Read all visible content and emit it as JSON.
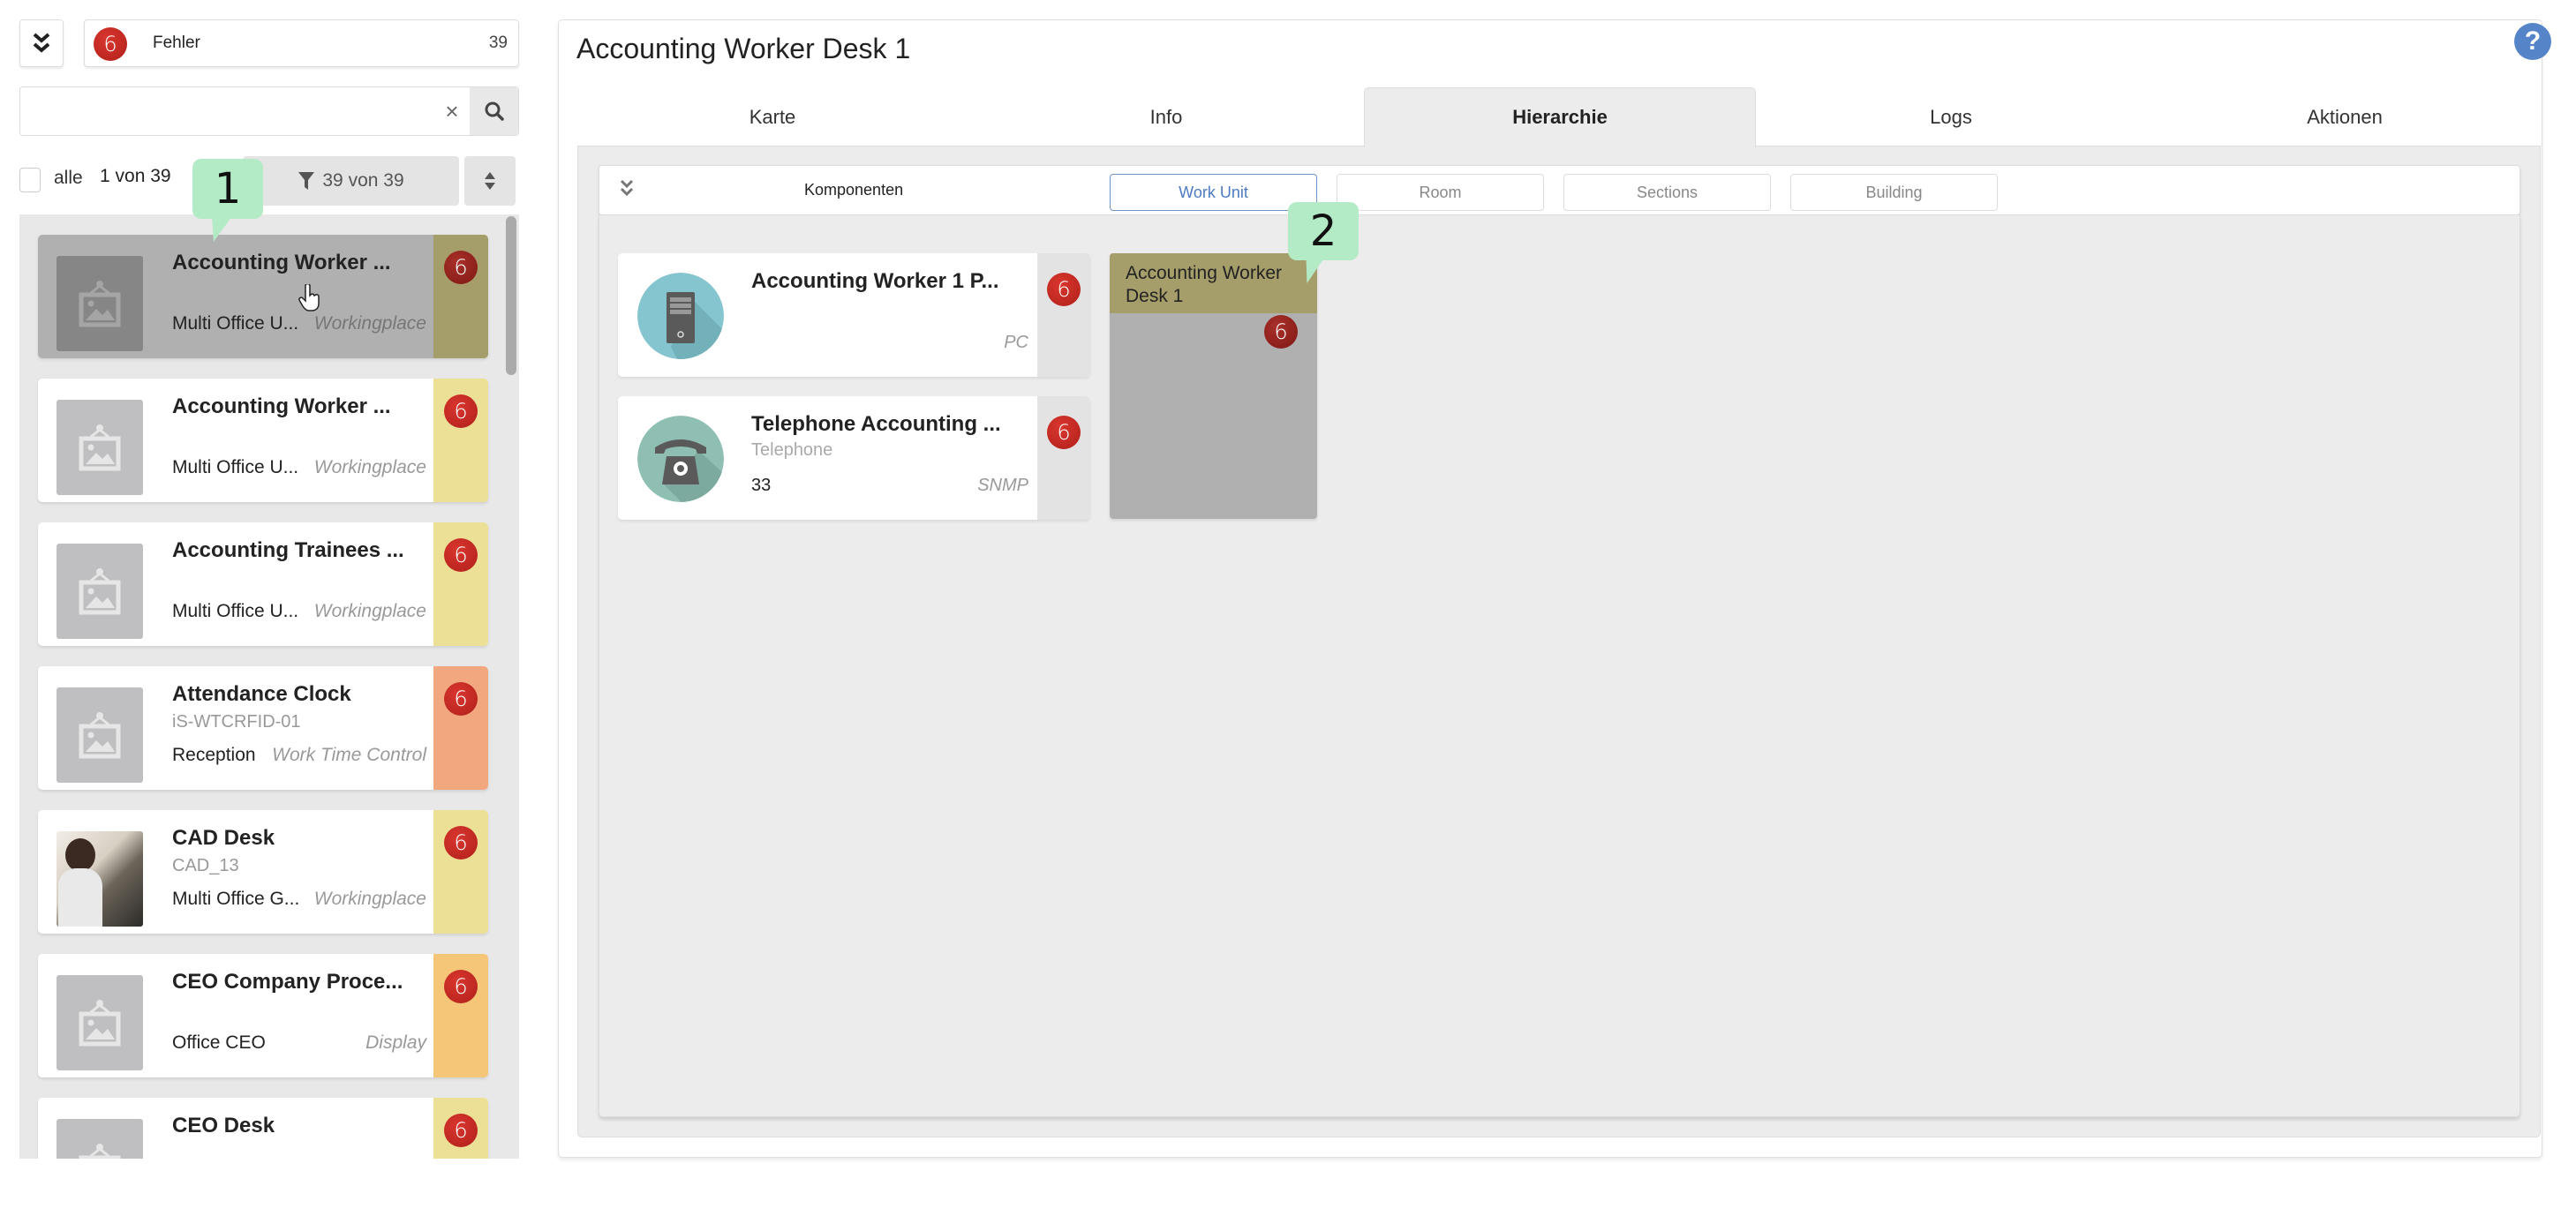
{
  "sidebar": {
    "status": {
      "badge": "6",
      "label": "Fehler",
      "count": "39"
    },
    "search": {
      "value": "",
      "placeholder": "",
      "clear": "×"
    },
    "select_all_label": "alle",
    "selection_count": "1 von 39",
    "filter_label": "39 von 39",
    "items": [
      {
        "name": "Accounting Worker ...",
        "code": "",
        "location": "Multi Office U...",
        "type": "Workingplace",
        "badge": "6",
        "stripe_color": "#a69e6a",
        "selected": true,
        "image": "placeholder"
      },
      {
        "name": "Accounting Worker ...",
        "code": "",
        "location": "Multi Office U...",
        "type": "Workingplace",
        "badge": "6",
        "stripe_color": "#ece096",
        "selected": false,
        "image": "placeholder"
      },
      {
        "name": "Accounting Trainees ...",
        "code": "",
        "location": "Multi Office U...",
        "type": "Workingplace",
        "badge": "6",
        "stripe_color": "#ece096",
        "selected": false,
        "image": "placeholder"
      },
      {
        "name": "Attendance Clock",
        "code": "iS-WTCRFID-01",
        "location": "Reception",
        "type": "Work Time Control",
        "badge": "6",
        "stripe_color": "#f2a87e",
        "selected": false,
        "image": "placeholder"
      },
      {
        "name": "CAD Desk",
        "code": "CAD_13",
        "location": "Multi Office G...",
        "type": "Workingplace",
        "badge": "6",
        "stripe_color": "#ece096",
        "selected": false,
        "image": "photo"
      },
      {
        "name": "CEO Company Proce...",
        "code": "",
        "location": "Office CEO",
        "type": "Display",
        "badge": "6",
        "stripe_color": "#f5c678",
        "selected": false,
        "image": "placeholder"
      },
      {
        "name": "CEO Desk",
        "code": "",
        "location": "",
        "type": "",
        "badge": "6",
        "stripe_color": "#ece096",
        "selected": false,
        "image": "placeholder"
      }
    ]
  },
  "callouts": {
    "first": "1",
    "second": "2"
  },
  "main": {
    "title": "Accounting Worker Desk 1",
    "tabs": [
      {
        "label": "Karte",
        "active": false
      },
      {
        "label": "Info",
        "active": false
      },
      {
        "label": "Hierarchie",
        "active": true
      },
      {
        "label": "Logs",
        "active": false
      },
      {
        "label": "Aktionen",
        "active": false
      }
    ],
    "hierarchy": {
      "label": "Komponenten",
      "levels": [
        {
          "label": "Work Unit",
          "active": true
        },
        {
          "label": "Room",
          "active": false
        },
        {
          "label": "Sections",
          "active": false
        },
        {
          "label": "Building",
          "active": false
        }
      ],
      "components": [
        {
          "name": "Accounting Worker 1 P...",
          "subtitle": "",
          "value": "",
          "type": "PC",
          "badge": "6",
          "icon": "pc-tower-icon",
          "icon_color": "#84c5cf"
        },
        {
          "name": "Telephone Accounting ...",
          "subtitle": "Telephone",
          "value": "33",
          "type": "SNMP",
          "badge": "6",
          "icon": "telephone-icon",
          "icon_color": "#8fbfb3"
        }
      ],
      "work_unit": {
        "name": "Accounting Worker Desk 1",
        "badge": "6",
        "header_color": "#a69e6a"
      }
    }
  },
  "colors": {
    "badge_red": "#c9271f",
    "help_blue": "#5585c8",
    "callout_green": "#b3ebc7",
    "active_level_blue": "#4d7ac0"
  }
}
